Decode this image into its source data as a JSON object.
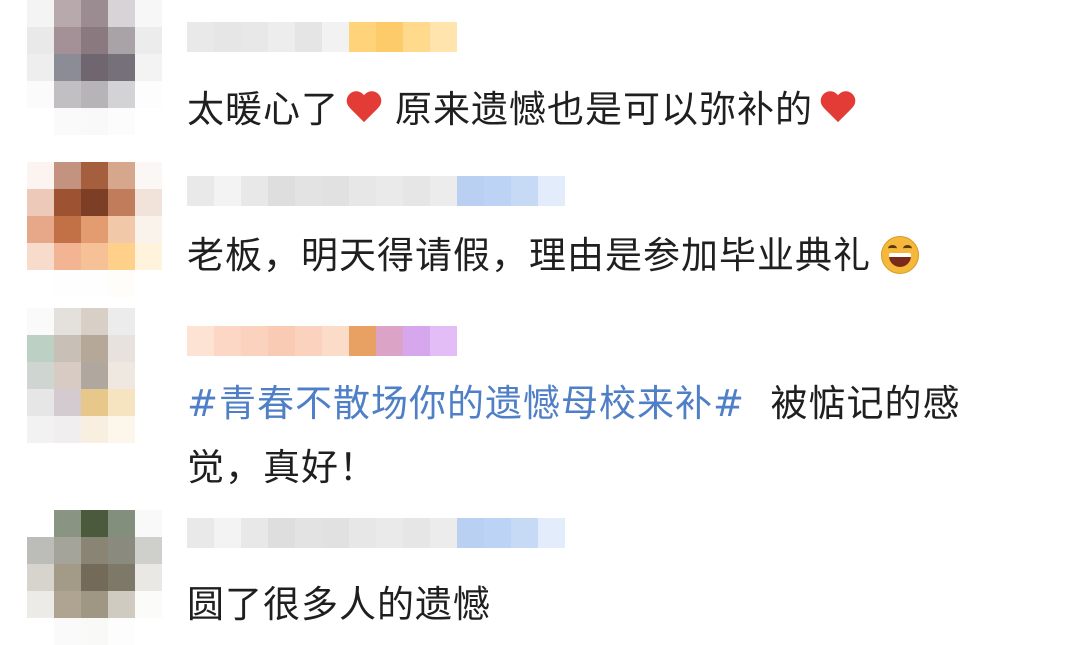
{
  "comments": [
    {
      "text_parts": [
        "太暖心了",
        "原来遗憾也是可以弥补的"
      ],
      "icons": [
        "heart-icon",
        "heart-icon"
      ],
      "avatar_colors": [
        "#f4f4f4",
        "#b8a9ad",
        "#9a8c91",
        "#d7d3d6",
        "#f7f7f7",
        "#e9e9ea",
        "#a39197",
        "#8a7a80",
        "#a9a2a6",
        "#ececed",
        "#eeeeee",
        "#8c8c96",
        "#6f6670",
        "#76707a",
        "#f3f3f3",
        "#fbfbfb",
        "#c2bfc3",
        "#b7b4b8",
        "#d3d2d5",
        "#fdfdfd",
        "#ffffff",
        "#fafafa",
        "#f9f9f9",
        "#fcfcfc",
        "#ffffff"
      ],
      "name_colors": [
        "#e9e9e9",
        "#e6e6e6",
        "#e8e8e8",
        "#ededed",
        "#e5e5e5",
        "#f2f2f2",
        "#ffd37a",
        "#fecb6a",
        "#ffd98c",
        "#ffe5ad"
      ]
    },
    {
      "text_parts": [
        "老板，明天得请假，理由是参加毕业典礼"
      ],
      "icons": [
        "laugh-icon"
      ],
      "avatar_colors": [
        "#fbf4f1",
        "#c49380",
        "#a65f3e",
        "#d6a68d",
        "#fbf7f5",
        "#ecc9b8",
        "#9d5232",
        "#7c3e24",
        "#c17c5b",
        "#f2e3da",
        "#e6a888",
        "#c27046",
        "#e39c70",
        "#f1c9a9",
        "#faf3ec",
        "#f8dccb",
        "#f2b492",
        "#f6c196",
        "#ffd089",
        "#fff3dc",
        "#ffffff",
        "#fefefe",
        "#fefefe",
        "#fffdfa",
        "#ffffff"
      ],
      "name_colors": [
        "#e9e9e9",
        "#f3f3f3",
        "#e8e8e8",
        "#dedede",
        "#e3e3e3",
        "#e1e1e1",
        "#e7e7e7",
        "#eaeaea",
        "#e6e6e6",
        "#ececec",
        "#b9d0f3",
        "#bcd3f5",
        "#c6daf6",
        "#e2ecfb"
      ]
    },
    {
      "topic": "#青春不散场你的遗憾母校来补#",
      "text_line1": "被惦记的感",
      "text_line2": "觉，真好！",
      "avatar_colors": [
        "#fafafa",
        "#e4e0dc",
        "#d8d0c7",
        "#ececec",
        "#ffffff",
        "#bcd1c4",
        "#c8c0b6",
        "#b5a898",
        "#e7e2dd",
        "#ffffff",
        "#cfd6d1",
        "#d8cbc4",
        "#b0a89e",
        "#efe8e1",
        "#ffffff",
        "#e6e6e6",
        "#d4cbd0",
        "#e8c88a",
        "#f6e3bf",
        "#ffffff",
        "#f2f2f2",
        "#f0eeee",
        "#f9efe0",
        "#fdf6ea",
        "#ffffff"
      ],
      "name_colors": [
        "#fde3d3",
        "#fcd7c6",
        "#fbd2bd",
        "#f9cbb4",
        "#fad2bd",
        "#fbdcc9",
        "#e8a063",
        "#dba4c6",
        "#d7a7ee",
        "#e2bdf6"
      ]
    },
    {
      "text_parts": [
        "圆了很多人的遗憾"
      ],
      "icons": [],
      "avatar_colors": [
        "#ffffff",
        "#8a9482",
        "#4b5a3d",
        "#828f7c",
        "#f9f9f9",
        "#bcbcb8",
        "#a5a49b",
        "#8a8474",
        "#8b8a7e",
        "#cfcfcb",
        "#d6d4cc",
        "#a49a88",
        "#736a59",
        "#7d7867",
        "#e9e8e4",
        "#ecebe7",
        "#aea491",
        "#a09684",
        "#cfcbc0",
        "#fbfbfa",
        "#ffffff",
        "#fafafa",
        "#f9f9f8",
        "#fdfdfd",
        "#ffffff"
      ],
      "name_colors": [
        "#e9e9e9",
        "#f3f3f3",
        "#e8e8e8",
        "#dedede",
        "#e3e3e3",
        "#e1e1e1",
        "#e7e7e7",
        "#eaeaea",
        "#e6e6e6",
        "#ececec",
        "#b9d0f3",
        "#bcd3f5",
        "#c6daf6",
        "#e2ecfb"
      ]
    }
  ]
}
